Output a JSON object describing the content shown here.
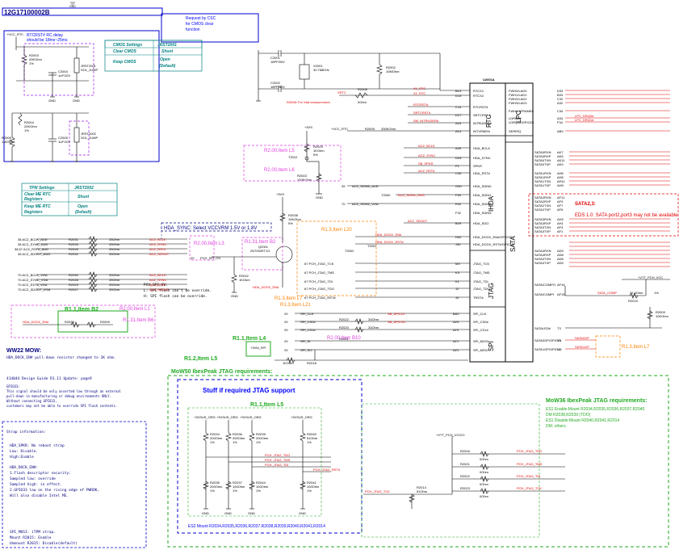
{
  "title": "12G17100002B",
  "csc_note": "Request by CSC for CMOS clear function",
  "rtcrst_note": [
    "RTCRST# RC delay",
    "should be 18ms~25ms"
  ],
  "cmos_table": {
    "header": [
      "CMOS Settings",
      "JRST2001"
    ],
    "rows": [
      [
        "Clear CMOS",
        "Shunt"
      ],
      [
        "Keep CMOS",
        "Open (Default)"
      ]
    ]
  },
  "tpm_table": {
    "header": [
      "TPM Settings",
      "JRST2002"
    ],
    "rows": [
      [
        "Clear ME RTC Registers",
        "Shunt"
      ],
      [
        "Keep ME RTC Registers",
        "Open (Default)"
      ]
    ]
  },
  "ic": {
    "ref": "U2001A",
    "sections": [
      "RTC",
      "LPC",
      "IHDA",
      "SATA",
      "JTAG",
      "SPI"
    ],
    "left_pins": [
      [
        "RTCX1",
        "B13"
      ],
      [
        "RTCX2",
        "D13"
      ],
      [
        "RTCRST#",
        "C14"
      ],
      [
        "SRTCRST#",
        "D17"
      ],
      [
        "INTRUDER#",
        "A16"
      ],
      [
        "INTVRMEN",
        "A14"
      ],
      [
        "HDA_BCLK",
        "A30"
      ],
      [
        "HDA_SYNC",
        "D29"
      ],
      [
        "SPKR",
        "P1"
      ],
      [
        "HDA_RST#",
        "C30"
      ],
      [
        "HDA_SDIN0",
        "G30"
      ],
      [
        "HDA_SDIN1",
        "F30"
      ],
      [
        "HDA_SDIN2",
        "E32"
      ],
      [
        "HDA_SDIN3",
        "F32"
      ],
      [
        "HDA_SDO",
        "B29"
      ],
      [
        "HDA_DOCK_EN#/GPIO33",
        "H32"
      ],
      [
        "HDA_DOCK_RST#/GPIO13",
        "J30"
      ],
      [
        "JTAG_TCK",
        "M3"
      ],
      [
        "JTAG_TMS",
        "K3"
      ],
      [
        "JTAG_TDI",
        "K1"
      ],
      [
        "JTAG_TDO",
        "J2"
      ],
      [
        "TRST#",
        "J4"
      ],
      [
        "SPI_CLK",
        "BA2"
      ],
      [
        "SPI_CS0#",
        "AV3"
      ],
      [
        "SPI_CS1#",
        "AY3"
      ],
      [
        "SPI_MOSI",
        "AY1"
      ],
      [
        "SPI_MISO",
        "AV1"
      ]
    ],
    "right_pins": [
      [
        "FWH0/LAD0",
        "D33"
      ],
      [
        "FWH1/LAD1",
        "B33"
      ],
      [
        "FWH2/LAD2",
        "C32"
      ],
      [
        "FWH3/LAD3",
        "A32"
      ],
      [
        "FWH4/LFRAME#",
        "C34"
      ],
      [
        "LDRQ0#",
        "A34"
      ],
      [
        "LDRQ1#/GPIO23",
        "F34"
      ],
      [
        "SERIRQ",
        "AB9"
      ],
      [
        "SATA0RXN",
        "AK7"
      ],
      [
        "SATA0RXP",
        "AK6"
      ],
      [
        "SATA0TXN",
        "AK11"
      ],
      [
        "SATA0TXP",
        "AK9"
      ],
      [
        "SATA1RXN",
        "AH6"
      ],
      [
        "SATA1RXP",
        "AH5"
      ],
      [
        "SATA1TXN",
        "AH11"
      ],
      [
        "SATA1TXP",
        "AH9"
      ],
      [
        "SATA2RXN",
        "AF11"
      ],
      [
        "SATA2RXP",
        "AF9"
      ],
      [
        "SATA2TXN",
        "AF7"
      ],
      [
        "SATA2TXP",
        "AF6"
      ],
      [
        "SATA3RXN",
        "AH3"
      ],
      [
        "SATA3RXP",
        "AH1"
      ],
      [
        "SATA3TXN",
        "AF3"
      ],
      [
        "SATA3TXP",
        "AF1"
      ],
      [
        "SATAICOMPO",
        "AD9"
      ],
      [
        "SATAICOMPI",
        "AD8"
      ],
      [
        "SATA_COMP",
        "AF16"
      ],
      [
        "SATALED#",
        "T3"
      ],
      [
        "SATA0GP/GPIO21",
        "Y9"
      ],
      [
        "SATA1GP/GPIO19",
        "V1"
      ]
    ]
  },
  "nets": {
    "xrtc": [
      "X1_RTC",
      "X2_RTC",
      "XRTC"
    ],
    "rtc": [
      "RTCRST#",
      "SRTCRST#",
      "SM_INTRUDER#",
      "PCH_INVRMEN",
      "+VCC_RTC",
      "+3VS"
    ],
    "hda": [
      "ACZ_BCLK",
      "ACZ_SYNC",
      "SB_SPKR",
      "ACZ_RST#",
      "ACZ_SDIN0_AUD",
      "ACZ_SDIN1_MDC",
      "ACZ_SDIN2_VGA",
      "ACZ_SDOUT",
      "HDA_DOCK_EN#",
      "HDA_DOCK_RST#"
    ],
    "jtag": [
      "PCH_JTAG_TCK",
      "PCH_JTAG_TMS",
      "PCH_JTAG_TDI",
      "PCH_JTAG_TDO",
      "PCH_JTAG_RST#"
    ],
    "spi": [
      "SPI_CLK",
      "SPI_CS0#",
      "SPI_CS1#",
      "SPI_SI",
      "SPI_SO",
      "SB_SPICLK",
      "SB_SPICS0"
    ],
    "lpc": [
      "LPC_DRQ0#",
      "LPC_DRQ1#"
    ],
    "sata": [
      "SATA_COMP",
      "+VTT_PCH_VCC",
      "+3VM_SPI",
      "+VTT_PCH_VCCIO",
      "+3VSUS_ORG",
      "+VCC_RTC"
    ]
  },
  "parts": [
    [
      "R2003",
      "20KOhm",
      "1%"
    ],
    [
      "C2004",
      "1uF/10V"
    ],
    [
      "JRST2001",
      "SOL_JUMP"
    ],
    [
      "R2004",
      "20KOhm",
      "1%"
    ],
    [
      "R2006",
      "1MOhm"
    ],
    [
      "C2005",
      "1uF/10V"
    ],
    [
      "JRST2002",
      "SOL_JUMP"
    ],
    [
      "C2001",
      "18PF/50V"
    ],
    [
      "X2001",
      "32.768KHz"
    ],
    [
      "C2002",
      "18PF/50V"
    ],
    [
      "R2002",
      "10MOhm"
    ],
    [
      "R2008",
      "0Ohm"
    ],
    [
      "R2005",
      "330KOhm"
    ],
    [
      "R2029",
      "1KOhm",
      "5%"
    ],
    [
      "T2012"
    ],
    [
      "R2043",
      "100KOhm"
    ],
    [
      "R2031",
      "33Ohm"
    ],
    [
      "R2033",
      "33Ohm"
    ],
    [
      "R2026",
      "33Ohm"
    ],
    [
      "R2032",
      "33Ohm"
    ],
    [
      "R2030",
      "33Ohm"
    ],
    [
      "R2028",
      "33Ohm"
    ],
    [
      "R2025",
      "33Ohm"
    ],
    [
      "R2027",
      "33Ohm"
    ],
    [
      "R2038",
      "10KOhm",
      "5%"
    ],
    [
      "Q2001",
      "2N7002ET1G"
    ],
    [
      "R2042",
      "1KOhm"
    ],
    [
      "R2039",
      "1KOhm"
    ],
    [
      "R2022",
      "33Ohm"
    ],
    [
      "R2020",
      "33Ohm"
    ],
    [
      "R2021",
      "33Ohm"
    ],
    [
      "R2018",
      "1KOhm"
    ],
    [
      "T2001"
    ],
    [
      "T2002"
    ],
    [
      "R2034",
      "200Ohm"
    ],
    [
      "R2036",
      "200Ohm"
    ],
    [
      "R2039",
      "200Ohm"
    ],
    [
      "R2040",
      "51Ohm"
    ],
    [
      "R2035",
      "200Ohm"
    ],
    [
      "R2037",
      "100Ohm"
    ],
    [
      "R2044",
      "100Ohm"
    ],
    [
      "R2041",
      "100Ohm"
    ],
    [
      "R2014",
      "51Ohm"
    ],
    [
      "R2016",
      "0Ohm"
    ],
    [
      "R2021",
      "0Ohm"
    ],
    [
      "R2022",
      "0Ohm"
    ],
    [
      "R2023",
      "0Ohm"
    ],
    [
      "R2019",
      "37.4Ohm",
      "1%"
    ],
    [
      "R2009",
      "10KOhm"
    ],
    [
      "R2010",
      "10KOhm"
    ]
  ],
  "annotations": [
    "R2.00,Item L5",
    "R2.00,Item L6",
    "HDA_SYNC: Select VCCVRM 1.5V or 1.8V",
    "R2.00,Item L3",
    "R1.31,Item B2",
    "R1.3,Item L20",
    "R1.3,Item L7",
    "R1.3,Item L21",
    "R1.1,Item B2",
    "R2.00,Item L1",
    "R1.31,Item B6",
    "R1.1,Item L4",
    "R1.2,Item L5",
    "R2.00,Item B10",
    "R1.3,Item L7",
    "R1.1,Item L5",
    "SATA2,3:",
    "EDS 1.0: SATA port2,port3 may not be available"
  ],
  "pch_notes": [
    "PCH_SPI_OV:",
    "L: SPI flash can't be override.",
    "H: SPI flash can be override."
  ],
  "ww22": {
    "title": "WW22 MOW:",
    "text": "HDA_DOCK_EN# pull-down resistor changed to 1K ohm."
  },
  "design_guide": {
    "title": "414044 Design Guide R1.11 Update: page9",
    "lines": [
      "GPIO33:",
      "This signal should be only asserted low through an external",
      "pull-down in manufacturing or debug environments ONLY.",
      "Without connecting GPIO33,",
      "customers may not be able to override SPI flash contents."
    ]
  },
  "strap": {
    "title": "Strap information:",
    "lines": [
      "HDA_SPKR: No reboot strap",
      "    Low: Disable.",
      "    High:Enable",
      "",
      "HDA_DOCK_EN#:",
      "   1.Flash descriptor security:",
      "       Sampled low: override",
      "       Sampled high: in effect.",
      "   2.GPIO33 low on the rising edge of PWROK,",
      "       Will also disable Intel ME.",
      "",
      "",
      "SPI_MOSI: iTPM strap.",
      "     Mount R2015: Enable",
      "     Unmount R2015: Disable(default)"
    ]
  },
  "mow50": "MoW50 IbexPeak JTAG requirements:",
  "stuff": "Stuff if required JTAG support",
  "es2": "ES2 Mount R2034,R2035,R2036,R2037,R2038,R2039,R2040,R2041,R2014",
  "mow36": {
    "title": "MoW36 IbexPeak JTAG requirements:",
    "lines": [
      "ES1 Enable:Mount R2034,R2035,R2036,R2037,R2040",
      "        DM R2038,R2039 (TDO)",
      "ES1 Disable:Mount R2040,R2041,R2014",
      "        DM: others."
    ]
  }
}
